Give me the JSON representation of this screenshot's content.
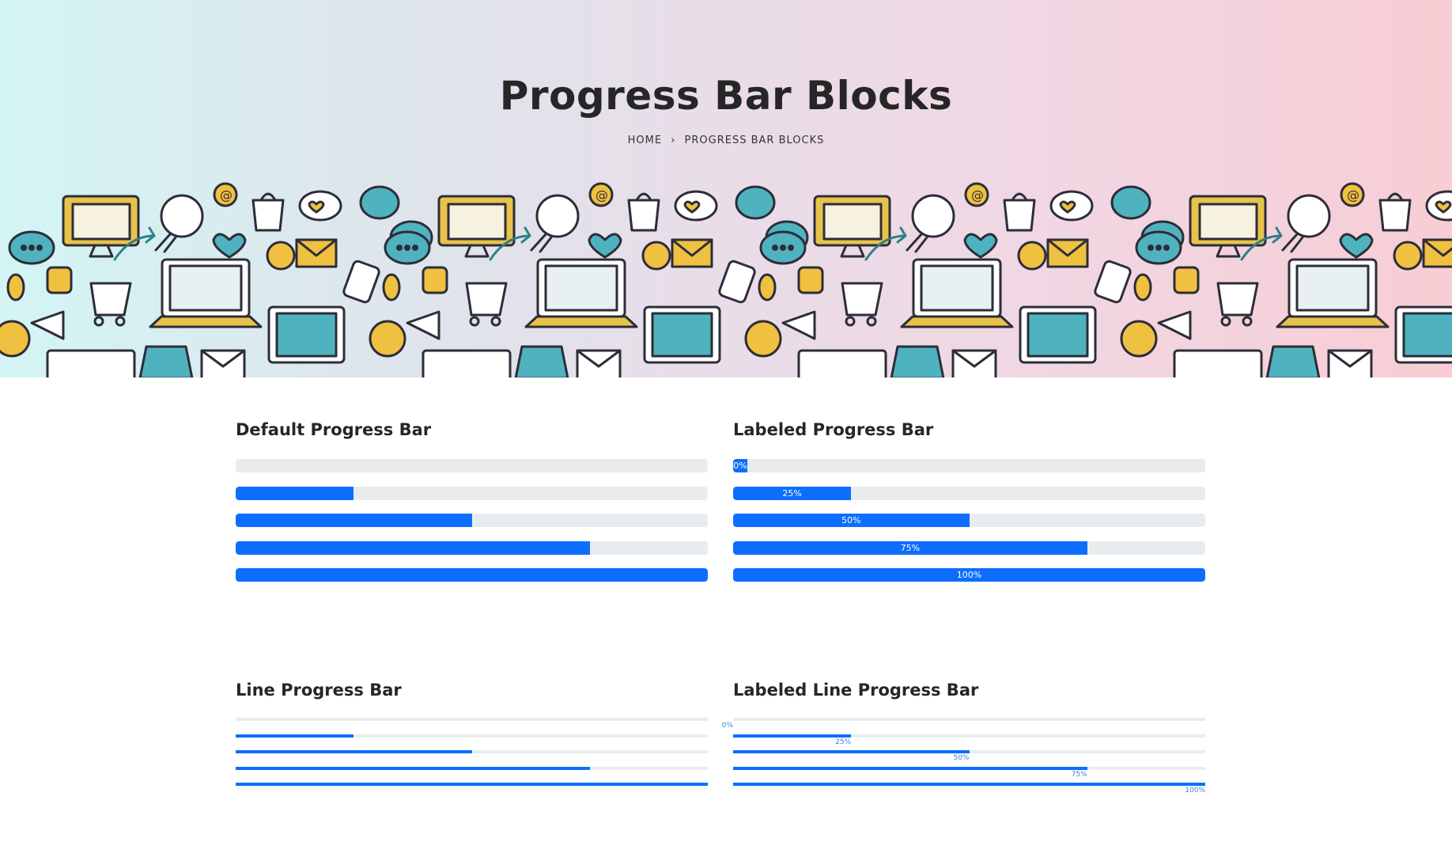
{
  "hero": {
    "title": "Progress Bar Blocks",
    "breadcrumb": {
      "home": "HOME",
      "separator": "›",
      "current": "PROGRESS BAR BLOCKS"
    }
  },
  "colors": {
    "accent": "#0d6efd",
    "track": "#e9ecef"
  },
  "default_block": {
    "title": "Default Progress Bar",
    "bars": [
      {
        "value": 0
      },
      {
        "value": 25
      },
      {
        "value": 50
      },
      {
        "value": 75
      },
      {
        "value": 100
      }
    ]
  },
  "labeled_block": {
    "title": "Labeled Progress Bar",
    "bars": [
      {
        "value": 0,
        "label": "0%"
      },
      {
        "value": 25,
        "label": "25%"
      },
      {
        "value": 50,
        "label": "50%"
      },
      {
        "value": 75,
        "label": "75%"
      },
      {
        "value": 100,
        "label": "100%"
      }
    ]
  },
  "line_block": {
    "title": "Line Progress Bar",
    "bars": [
      {
        "value": 0
      },
      {
        "value": 25
      },
      {
        "value": 50
      },
      {
        "value": 75
      },
      {
        "value": 100
      }
    ]
  },
  "labeled_line_block": {
    "title": "Labeled Line Progress Bar",
    "bars": [
      {
        "value": 0,
        "label": "0%"
      },
      {
        "value": 25,
        "label": "25%"
      },
      {
        "value": 50,
        "label": "50%"
      },
      {
        "value": 75,
        "label": "75%"
      },
      {
        "value": 100,
        "label": "100%"
      }
    ]
  }
}
